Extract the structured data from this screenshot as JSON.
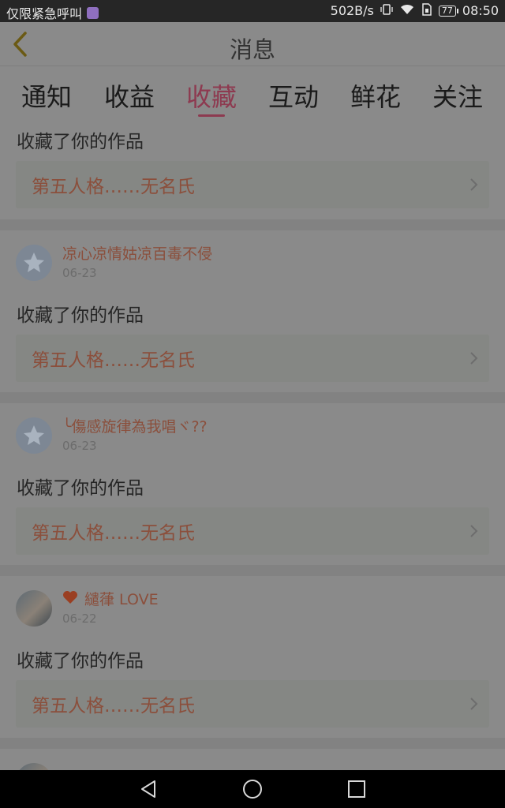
{
  "status_bar": {
    "left_text": "仅限紧急呼叫",
    "speed": "502B/s",
    "battery": "77",
    "time": "08:50",
    "icons": [
      "notification-icon",
      "vibrate-icon",
      "wifi-icon",
      "sim-icon",
      "battery-icon"
    ]
  },
  "header": {
    "title": "消息",
    "back_icon": "chevron-left-icon"
  },
  "tabs": [
    {
      "label": "通知"
    },
    {
      "label": "收益"
    },
    {
      "label": "收藏",
      "active": true
    },
    {
      "label": "互动"
    },
    {
      "label": "鲜花"
    },
    {
      "label": "关注"
    }
  ],
  "items": [
    {
      "action": "收藏了你的作品",
      "work_title": "第五人格……无名氏"
    },
    {
      "username": "凉心凉情姑凉百毒不侵",
      "date": "06-23",
      "avatar": "default-avatar-icon",
      "action": "收藏了你的作品",
      "work_title": "第五人格……无名氏"
    },
    {
      "username": "╰傷感旋律為我唱ヾ??",
      "date": "06-23",
      "avatar": "default-avatar-icon",
      "action": "收藏了你的作品",
      "work_title": "第五人格……无名氏"
    },
    {
      "username": "繾葎 LOVE",
      "date": "06-22",
      "avatar": "photo-avatar",
      "badge": "heart-icon",
      "action": "收藏了你的作品",
      "work_title": "第五人格……无名氏"
    }
  ],
  "colors": {
    "accent": "#8d3a50",
    "link": "#8b4f3c",
    "overlay_bg": "#8a8a8a"
  },
  "navbar": {
    "icons": [
      "back-triangle-icon",
      "home-circle-icon",
      "recents-square-icon"
    ]
  }
}
